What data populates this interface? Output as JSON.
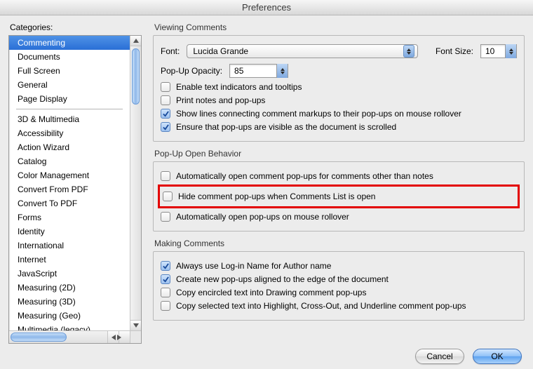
{
  "window": {
    "title": "Preferences"
  },
  "sidebar": {
    "label": "Categories:",
    "group1": [
      "Commenting",
      "Documents",
      "Full Screen",
      "General",
      "Page Display"
    ],
    "group2": [
      "3D & Multimedia",
      "Accessibility",
      "Action Wizard",
      "Catalog",
      "Color Management",
      "Convert From PDF",
      "Convert To PDF",
      "Forms",
      "Identity",
      "International",
      "Internet",
      "JavaScript",
      "Measuring (2D)",
      "Measuring (3D)",
      "Measuring (Geo)",
      "Multimedia (legacy)"
    ],
    "selected_index": 0
  },
  "sections": {
    "viewing": {
      "title": "Viewing Comments",
      "font_label": "Font:",
      "font_value": "Lucida Grande",
      "font_size_label": "Font Size:",
      "font_size_value": "10",
      "opacity_label": "Pop-Up Opacity:",
      "opacity_value": "85",
      "checks": [
        {
          "label": "Enable text indicators and tooltips",
          "checked": false
        },
        {
          "label": "Print notes and pop-ups",
          "checked": false
        },
        {
          "label": "Show lines connecting comment markups to their pop-ups on mouse rollover",
          "checked": true
        },
        {
          "label": "Ensure that pop-ups are visible as the document is scrolled",
          "checked": true
        }
      ]
    },
    "popup": {
      "title": "Pop-Up Open Behavior",
      "checks": [
        {
          "label": "Automatically open comment pop-ups for comments other than notes",
          "checked": false
        },
        {
          "label": "Hide comment pop-ups when Comments List is open",
          "checked": false,
          "highlight": true
        },
        {
          "label": "Automatically open pop-ups on mouse rollover",
          "checked": false
        }
      ]
    },
    "making": {
      "title": "Making Comments",
      "checks": [
        {
          "label": "Always use Log-in Name for Author name",
          "checked": true
        },
        {
          "label": "Create new pop-ups aligned to the edge of the document",
          "checked": true
        },
        {
          "label": "Copy encircled text into Drawing comment pop-ups",
          "checked": false
        },
        {
          "label": "Copy selected text into Highlight, Cross-Out, and Underline comment pop-ups",
          "checked": false
        }
      ]
    }
  },
  "footer": {
    "cancel": "Cancel",
    "ok": "OK"
  }
}
